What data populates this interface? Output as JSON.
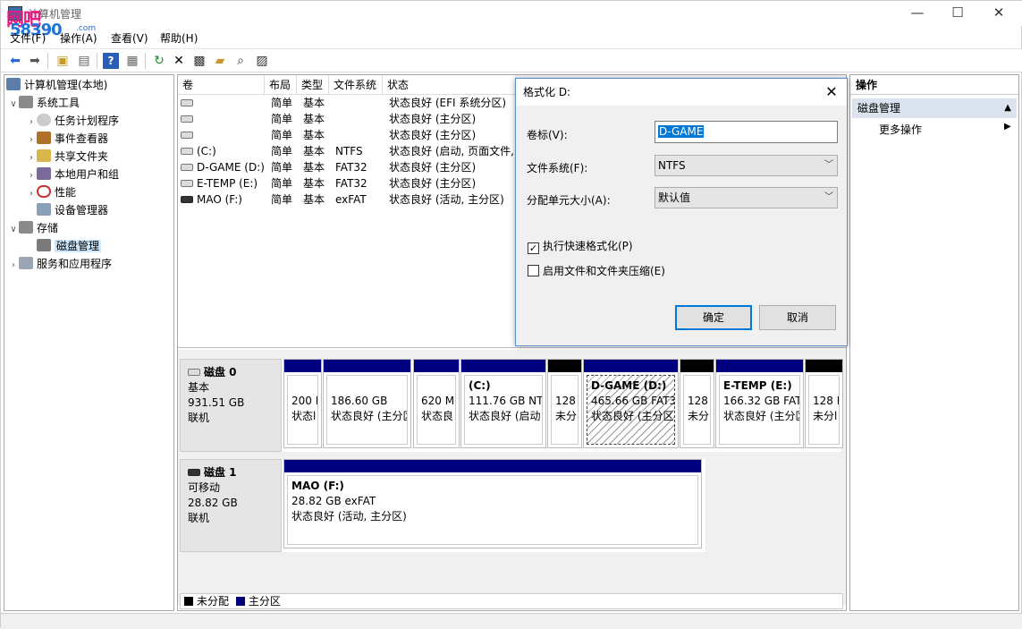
{
  "window": {
    "title": "计算机管理",
    "minimize": "—",
    "maximize": "☐",
    "close": "✕"
  },
  "watermark": {
    "line1": "网吧",
    "line2": "58390",
    "suffix": ".com"
  },
  "menus": [
    "文件(F)",
    "操作(A)",
    "查看(V)",
    "帮助(H)"
  ],
  "toolbar": {
    "back": "back-icon",
    "forward": "forward-icon",
    "up": "up-icon",
    "show_hide": "console-tree-icon",
    "help": "help-icon",
    "view": "view-icon",
    "refresh": "refresh-icon",
    "delete": "delete-icon",
    "properties": "properties-icon",
    "open": "open-icon",
    "search": "search-icon",
    "settings": "settings-icon"
  },
  "tree": {
    "root": "计算机管理(本地)",
    "system_tools": "系统工具",
    "task_scheduler": "任务计划程序",
    "event_viewer": "事件查看器",
    "shared_folders": "共享文件夹",
    "local_users": "本地用户和组",
    "performance": "性能",
    "device_manager": "设备管理器",
    "storage": "存储",
    "disk_management": "磁盘管理",
    "services_apps": "服务和应用程序"
  },
  "volume_list": {
    "headers": [
      "卷",
      "布局",
      "类型",
      "文件系统",
      "状态"
    ],
    "rows": [
      {
        "vol": "",
        "layout": "简单",
        "type": "基本",
        "fs": "",
        "status": "状态良好 (EFI 系统分区)"
      },
      {
        "vol": "",
        "layout": "简单",
        "type": "基本",
        "fs": "",
        "status": "状态良好 (主分区)"
      },
      {
        "vol": "",
        "layout": "简单",
        "type": "基本",
        "fs": "",
        "status": "状态良好 (主分区)"
      },
      {
        "vol": "(C:)",
        "layout": "简单",
        "type": "基本",
        "fs": "NTFS",
        "status": "状态良好 (启动, 页面文件,"
      },
      {
        "vol": "D-GAME (D:)",
        "layout": "简单",
        "type": "基本",
        "fs": "FAT32",
        "status": "状态良好 (主分区)"
      },
      {
        "vol": "E-TEMP (E:)",
        "layout": "简单",
        "type": "基本",
        "fs": "FAT32",
        "status": "状态良好 (主分区)"
      },
      {
        "vol": "MAO (F:)",
        "layout": "简单",
        "type": "基本",
        "fs": "exFAT",
        "status": "状态良好 (活动, 主分区)"
      }
    ]
  },
  "disk0": {
    "name": "磁盘 0",
    "kind": "基本",
    "size": "931.51 GB",
    "state": "联机",
    "parts": [
      {
        "l1": "",
        "l2": "200 I",
        "l3": "状态l"
      },
      {
        "l1": "",
        "l2": "186.60 GB",
        "l3": "状态良好 (主分区"
      },
      {
        "l1": "",
        "l2": "620 M",
        "l3": "状态良"
      },
      {
        "l1": "(C:)",
        "l2": "111.76 GB NT",
        "l3": "状态良好 (启动"
      },
      {
        "l1": "",
        "l2": "128",
        "l3": "未分"
      },
      {
        "l1": "D-GAME  (D:)",
        "l2": "465.66 GB FAT3",
        "l3": "状态良好 (主分区"
      },
      {
        "l1": "",
        "l2": "128",
        "l3": "未分"
      },
      {
        "l1": "E-TEMP  (E:)",
        "l2": "166.32 GB FAT",
        "l3": "状态良好 (主分区"
      },
      {
        "l1": "",
        "l2": "128 I",
        "l3": "未分l"
      }
    ]
  },
  "disk1": {
    "name": "磁盘 1",
    "kind": "可移动",
    "size": "28.82 GB",
    "state": "联机",
    "part": {
      "l1": "MAO  (F:)",
      "l2": "28.82 GB exFAT",
      "l3": "状态良好 (活动, 主分区)"
    }
  },
  "legend": {
    "unallocated": "未分配",
    "primary": "主分区",
    "unallocated_color": "#000000",
    "primary_color": "#00007f"
  },
  "actions": {
    "header": "操作",
    "section": "磁盘管理",
    "more": "更多操作"
  },
  "dialog": {
    "title": "格式化 D:",
    "label_volume": "卷标(V):",
    "volume_value": "D-GAME",
    "label_fs": "文件系统(F):",
    "fs_value": "NTFS",
    "label_alloc": "分配单元大小(A):",
    "alloc_value": "默认值",
    "quick_format": "执行快速格式化(P)",
    "quick_format_checked": true,
    "compression": "启用文件和文件夹压缩(E)",
    "compression_checked": false,
    "ok": "确定",
    "cancel": "取消"
  }
}
